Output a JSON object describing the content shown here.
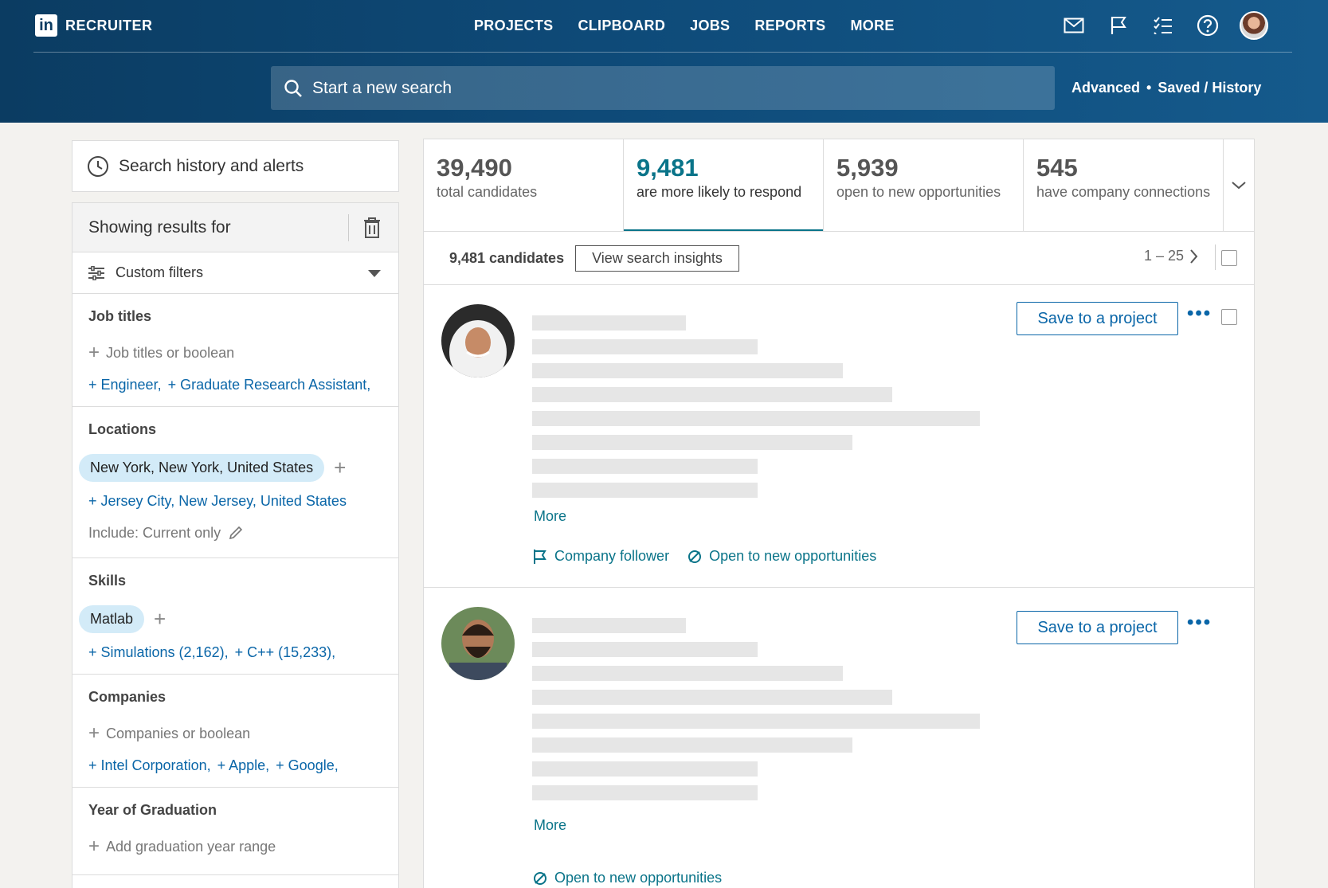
{
  "header": {
    "brand_logo": "in",
    "brand_name": "RECRUITER",
    "nav": [
      "PROJECTS",
      "CLIPBOARD",
      "JOBS",
      "REPORTS",
      "MORE"
    ],
    "icons": [
      "mail-icon",
      "flag-icon",
      "tasks-icon",
      "help-icon"
    ],
    "search_placeholder": "Start a new search",
    "advanced_label": "Advanced",
    "bullet": "•",
    "saved_history_label": "Saved / History",
    "accent": "#0b3c62"
  },
  "sidebar": {
    "history_label": "Search history and alerts",
    "showing_results_label": "Showing results for",
    "custom_filters_label": "Custom filters",
    "job_titles": {
      "title": "Job titles",
      "add_placeholder": "Job titles or boolean",
      "suggestions": [
        "+ Engineer,",
        "+ Graduate Research Assistant,"
      ]
    },
    "locations": {
      "title": "Locations",
      "selected": "New York, New York, United States",
      "suggestion": "+ Jersey City, New Jersey, United States",
      "include_label": "Include: Current only"
    },
    "skills": {
      "title": "Skills",
      "selected": "Matlab",
      "suggestions": [
        "+ Simulations (2,162),",
        "+ C++ (15,233),"
      ]
    },
    "companies": {
      "title": "Companies",
      "add_placeholder": "Companies or boolean",
      "suggestions": [
        "+ Intel Corporation,",
        "+ Apple,",
        "+ Google,"
      ]
    },
    "graduation": {
      "title": "Year of Graduation",
      "add_placeholder": "Add graduation year range"
    }
  },
  "stats": [
    {
      "num": "39,490",
      "label": "total candidates"
    },
    {
      "num": "9,481",
      "label": "are more likely to respond"
    },
    {
      "num": "5,939",
      "label": "open to new opportunities"
    },
    {
      "num": "545",
      "label": "have company connections"
    }
  ],
  "results": {
    "count_label": "9,481 candidates",
    "insights_label": "View search insights",
    "pager_label": "1 – 25",
    "candidates": [
      {
        "save_label": "Save to a project",
        "more_label": "More",
        "badges": [
          "Company follower",
          "Open to new opportunities"
        ]
      },
      {
        "save_label": "Save to a project",
        "more_label": "More",
        "badges": [
          "Open to new opportunities"
        ]
      }
    ],
    "dots": "•••",
    "link_color": "#0a7489"
  }
}
